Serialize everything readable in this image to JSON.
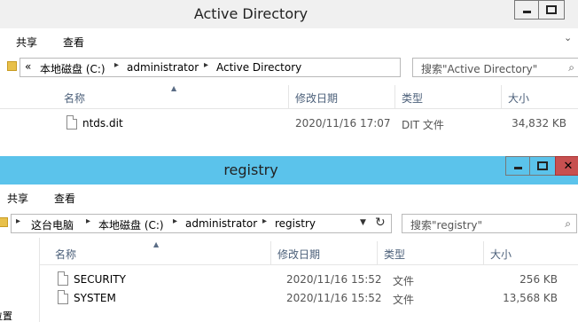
{
  "top_window": {
    "title": "Active Directory",
    "ribbon": {
      "share": "共享",
      "view": "查看"
    },
    "breadcrumb": {
      "overflow": "«",
      "drive": "本地磁盘 (C:)",
      "folder1": "administrator",
      "folder2": "Active Directory"
    },
    "search_placeholder": "搜索\"Active Directory\"",
    "columns": {
      "name": "名称",
      "modified": "修改日期",
      "type": "类型",
      "size": "大小"
    },
    "files": [
      {
        "name": "ntds.dit",
        "modified": "2020/11/16 17:07",
        "type": "DIT 文件",
        "size": "34,832 KB"
      }
    ]
  },
  "bottom_window": {
    "title": "registry",
    "ribbon": {
      "share": "共享",
      "view": "查看"
    },
    "breadcrumb": {
      "root": "这台电脑",
      "drive": "本地磁盘 (C:)",
      "folder1": "administrator",
      "folder2": "registry"
    },
    "search_placeholder": "搜索\"registry\"",
    "columns": {
      "name": "名称",
      "modified": "修改日期",
      "type": "类型",
      "size": "大小"
    },
    "files": [
      {
        "name": "SECURITY",
        "modified": "2020/11/16 15:52",
        "type": "文件",
        "size": "256 KB"
      },
      {
        "name": "SYSTEM",
        "modified": "2020/11/16 15:52",
        "type": "文件",
        "size": "13,568 KB"
      }
    ],
    "nav_fragment": "位置"
  },
  "colors": {
    "accent_titlebar": "#5bc3eb",
    "close_button": "#c75050"
  }
}
